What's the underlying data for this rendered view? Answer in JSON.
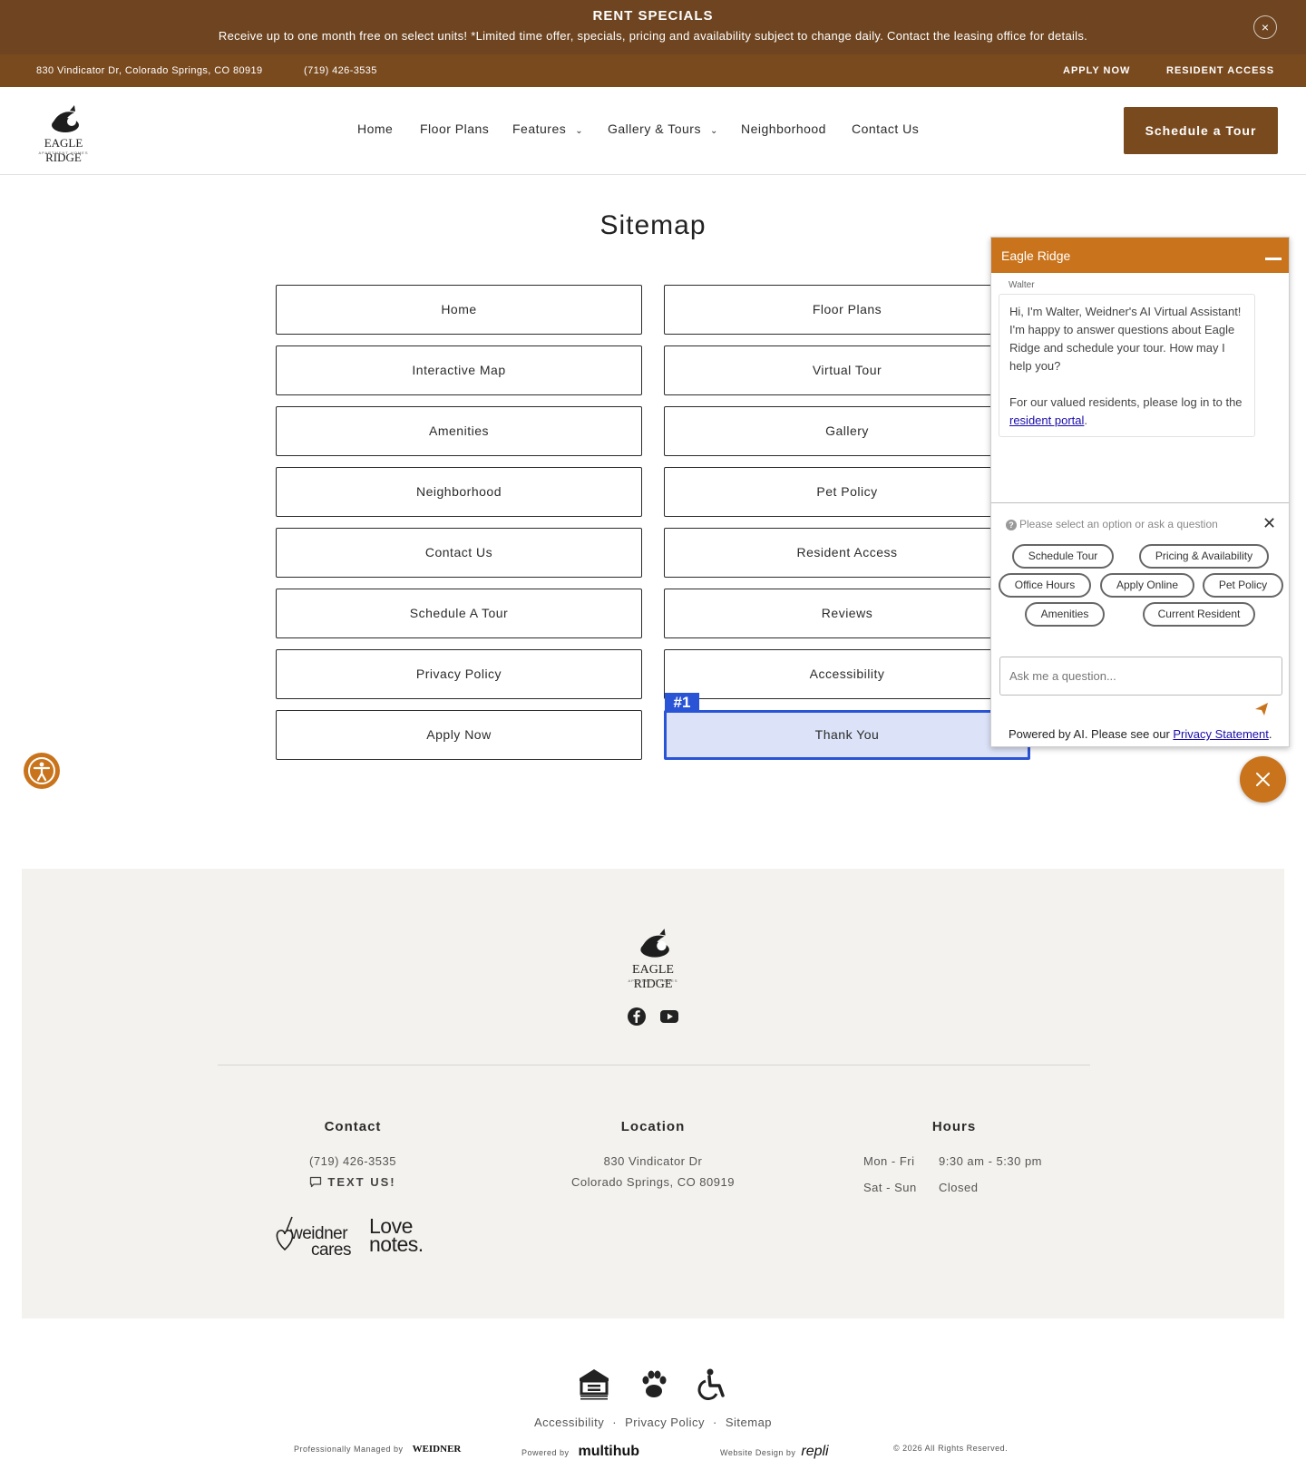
{
  "banner": {
    "title": "RENT SPECIALS",
    "text": "Receive up to one month free on select units! *Limited time offer, specials, pricing and availability subject to change daily. Contact the leasing office for details.",
    "close_icon": "×"
  },
  "info_bar": {
    "address": "830 Vindicator Dr, Colorado Springs, CO 80919",
    "phone": "(719) 426-3535",
    "apply": "APPLY NOW",
    "resident": "RESIDENT ACCESS"
  },
  "header": {
    "logo_text": "EAGLE RIDGE",
    "logo_sub": "APARTMENT HOMES",
    "nav": [
      "Home",
      "Floor Plans",
      "Features",
      "Gallery & Tours",
      "Neighborhood",
      "Contact Us"
    ],
    "cta": "Schedule a Tour"
  },
  "sitemap": {
    "title": "Sitemap",
    "left": [
      "Home",
      "Interactive Map",
      "Amenities",
      "Neighborhood",
      "Contact Us",
      "Schedule A Tour",
      "Privacy Policy",
      "Apply Now"
    ],
    "right": [
      "Floor Plans",
      "Virtual Tour",
      "Gallery",
      "Pet Policy",
      "Resident Access",
      "Reviews",
      "Accessibility",
      "Thank You"
    ],
    "badge": "#1"
  },
  "chat": {
    "title": "Eagle Ridge",
    "sender": "Walter",
    "message_1": "Hi, I'm Walter, Weidner's AI Virtual Assistant! I'm happy to answer questions about Eagle Ridge and schedule your tour. How may I help you?",
    "message_2_prefix": "For our valued residents, please log in to the ",
    "message_2_link": "resident portal",
    "message_2_suffix": ".",
    "prompt": "Please select an option or ask a question",
    "options": [
      "Schedule Tour",
      "Pricing & Availability",
      "Office Hours",
      "Apply Online",
      "Pet Policy",
      "Amenities",
      "Current Resident"
    ],
    "input_placeholder": "Ask me a question...",
    "footer_prefix": "Powered by AI. Please see our ",
    "footer_link": "Privacy Statement",
    "footer_suffix": "."
  },
  "footer": {
    "logo_text": "EAGLE RIDGE",
    "logo_sub": "APARTMENT HOMES",
    "contact": {
      "title": "Contact",
      "phone": "(719) 426-3535",
      "text_us": "TEXT US!"
    },
    "location": {
      "title": "Location",
      "line1": "830 Vindicator Dr",
      "line2": "Colorado Springs, CO 80919"
    },
    "hours": {
      "title": "Hours",
      "rows": [
        {
          "days": "Mon - Fri",
          "time": "9:30 am - 5:30 pm"
        },
        {
          "days": "Sat - Sun",
          "time": "Closed"
        }
      ]
    },
    "brands": {
      "weidner_cares_1": "weidner",
      "weidner_cares_2": "cares",
      "love_notes_1": "Love",
      "love_notes_2": "notes."
    }
  },
  "bottom": {
    "links": [
      "Accessibility",
      "Privacy Policy",
      "Sitemap"
    ],
    "managed_prefix": "Professionally Managed by",
    "managed_brand": "WEIDNER",
    "powered_prefix": "Powered by",
    "powered_brand": "multihub",
    "design_prefix": "Website Design by",
    "design_brand": "repli",
    "copyright": "© 2026 All Rights Reserved."
  },
  "colors": {
    "banner": "#6e4520",
    "brand_brown": "#7a4a1f",
    "chat_orange": "#c9741c",
    "highlight_blue": "#2a54d6"
  }
}
